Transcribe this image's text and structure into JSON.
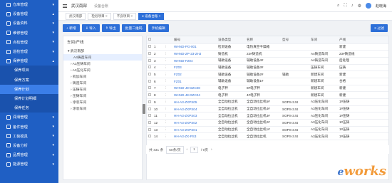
{
  "sidebar": {
    "items": [
      {
        "label": "仓库管理",
        "caret": "▾",
        "cls": ""
      },
      {
        "label": "设备管理",
        "caret": "▴",
        "cls": ""
      },
      {
        "label": "设备资料",
        "caret": "▾",
        "cls": ""
      },
      {
        "label": "维修管理",
        "caret": "▾",
        "cls": ""
      },
      {
        "label": "点检管理",
        "caret": "▾",
        "cls": ""
      },
      {
        "label": "巡检管理",
        "caret": "▾",
        "cls": ""
      },
      {
        "label": "保养管理",
        "caret": "▴",
        "cls": ""
      },
      {
        "label": "保养项目",
        "caret": "",
        "cls": "sub"
      },
      {
        "label": "保养方案",
        "caret": "",
        "cls": "sub"
      },
      {
        "label": "保养计划",
        "caret": "",
        "cls": "sub active"
      },
      {
        "label": "保养计划明细",
        "caret": "",
        "cls": "sub"
      },
      {
        "label": "保养任务",
        "caret": "",
        "cls": "sub"
      },
      {
        "label": "润滑管理",
        "caret": "▾",
        "cls": ""
      },
      {
        "label": "备件管理",
        "caret": "▾",
        "cls": ""
      },
      {
        "label": "工装模具",
        "caret": "▾",
        "cls": ""
      },
      {
        "label": "设备分析",
        "caret": "▾",
        "cls": ""
      },
      {
        "label": "品质管理",
        "caret": "▾",
        "cls": ""
      },
      {
        "label": "能源管理",
        "caret": "▾",
        "cls": ""
      }
    ]
  },
  "topbar": {
    "brand": "武汉南部",
    "crumb": "设备台账",
    "user": "赵晓海",
    "icons": [
      "search-icon",
      "fullscreen-icon",
      "bell-icon",
      "settings-icon"
    ]
  },
  "tabs": [
    {
      "label": "武汉南部",
      "active": false
    },
    {
      "label": "检验项目 ×",
      "active": false
    },
    {
      "label": "不良项目 ×",
      "active": false
    },
    {
      "label": "● 设备台账 ×",
      "active": true
    }
  ],
  "toolbar": {
    "add": "+ 新增",
    "import": "⇓ 导入",
    "export": "⇑ 导出",
    "qrcode": "批量二维码",
    "print": "手机编辑",
    "right": "≡ 过滤"
  },
  "tree": {
    "header": "车间/产线",
    "nodes": [
      {
        "label": "▾ 武汉南部",
        "sel": false,
        "indent": 6
      },
      {
        "label": "A4铸造车间",
        "sel": true,
        "indent": 14
      },
      {
        "label": "› A3压铸车间",
        "sel": false,
        "indent": 10
      },
      {
        "label": "› A3压化车间",
        "sel": false,
        "indent": 10
      },
      {
        "label": "› 机加车间",
        "sel": false,
        "indent": 10
      },
      {
        "label": "› 铸造车间",
        "sel": false,
        "indent": 10
      },
      {
        "label": "› 压铸车间",
        "sel": false,
        "indent": 10
      },
      {
        "label": "› 压铸车间",
        "sel": false,
        "indent": 10
      },
      {
        "label": "› 涂装车间",
        "sel": false,
        "indent": 10
      },
      {
        "label": "› 涂装车间",
        "sel": false,
        "indent": 10
      }
    ]
  },
  "table": {
    "headers": [
      "",
      "",
      "",
      "编号",
      "设备类型",
      "名称",
      "型号",
      "车间",
      "产线"
    ],
    "rows": [
      [
        "1",
        "WHND-PG-001",
        "检测设备",
        "电热真空干燥箱",
        "",
        "",
        "新建"
      ],
      [
        "2",
        "WHND-ZP-23-ZHJ",
        "铸造机",
        "23#铸造机",
        "",
        "A4铸造车间",
        "23#铸造线"
      ],
      [
        "3",
        "WHND-FZ04",
        "辅助设备",
        "辅助设备4#",
        "",
        "A4铸造车间",
        "后处理"
      ],
      [
        "4",
        "FZ03",
        "辅助设备",
        "辅助设备3#",
        "",
        "压铸车间",
        "压铸"
      ],
      [
        "5",
        "FZ02",
        "辅助设备",
        "辅助设备2#",
        "辅助",
        "新建车间",
        "新建"
      ],
      [
        "6",
        "FZ01",
        "辅助设备",
        "辅助设备1#",
        "",
        "新建车间",
        "合格"
      ],
      [
        "7",
        "WHND-J8-DZC08",
        "电子秤",
        "8#电子秤",
        "",
        "新建车间",
        "新建"
      ],
      [
        "8",
        "WHND-J8-DZC04",
        "电子秤",
        "4#电子秤",
        "",
        "新建车间",
        "新建"
      ],
      [
        "9",
        "HH-A3-ZXPS05",
        "全自动拉丝机",
        "全自动拉丝机5#",
        "SOPS-3.5t",
        "A3压化车间",
        "1#压铸"
      ],
      [
        "10",
        "HH-A3-ZXPS04",
        "全自动拉丝机",
        "全自动拉丝机4#",
        "SOPS-3.5t",
        "A3压化车间",
        "1#压铸"
      ],
      [
        "11",
        "HH-A3-ZXPS03",
        "全自动拉丝机",
        "全自动拉丝机3#",
        "SOPS-3.5t",
        "A3压化车间",
        "1#压铸"
      ],
      [
        "12",
        "HH-A3-ZXPS02",
        "全自动拉丝机",
        "全自动拉丝机2#",
        "SOPS-3.5t",
        "A3压化车间",
        "1#压铸"
      ],
      [
        "13",
        "HH-A3-ZXPS01",
        "全自动拉丝机",
        "全自动拉丝机1#",
        "SOPS-3.5t",
        "A3压化车间",
        "1#压铸"
      ],
      [
        "14",
        "HH-A3-ZX-PS3",
        "全自动拉丝机",
        "全自动拉丝机",
        "SOPS-3.5t",
        "A3压化车间",
        "1#压铸"
      ]
    ]
  },
  "pager": {
    "total": "共 431 条",
    "size": "50条/页",
    "prev": "‹",
    "page": "1",
    "pages": "/ 9页",
    "next": "›"
  },
  "watermark": {
    "e": "e",
    "text": "works"
  }
}
